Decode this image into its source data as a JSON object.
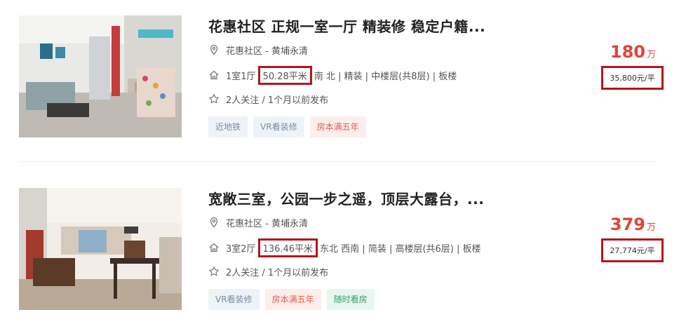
{
  "listings": [
    {
      "title": "花惠社区 正规一室一厅 精装修 稳定户籍...",
      "location": "花惠社区 - 黄埔永清",
      "layout": "1室1厅",
      "area": "50.28平米",
      "details": "南 北 | 精装 | 中楼层(共8层) | 板楼",
      "follow": "2人关注 / 1个月以前发布",
      "tags": [
        {
          "label": "近地铁",
          "style": "blue"
        },
        {
          "label": "VR看装修",
          "style": "blue"
        },
        {
          "label": "房本满五年",
          "style": "red"
        }
      ],
      "price": "180",
      "price_unit": "万",
      "unit_price": "35,800元/平"
    },
    {
      "title": "宽敞三室，公园一步之遥，顶层大露台，...",
      "location": "花惠社区 - 黄埔永清",
      "layout": "3室2厅",
      "area": "136.46平米",
      "details": "东北 西南 | 简装 | 高楼层(共6层) | 板楼",
      "follow": "2人关注 / 1个月以前发布",
      "tags": [
        {
          "label": "VR看装修",
          "style": "blue"
        },
        {
          "label": "房本满五年",
          "style": "red"
        },
        {
          "label": "随时看房",
          "style": "green"
        }
      ],
      "price": "379",
      "price_unit": "万",
      "unit_price": "27,774元/平"
    }
  ],
  "colors": {
    "price": "#e0443a",
    "highlight_box": "#b5151b"
  }
}
